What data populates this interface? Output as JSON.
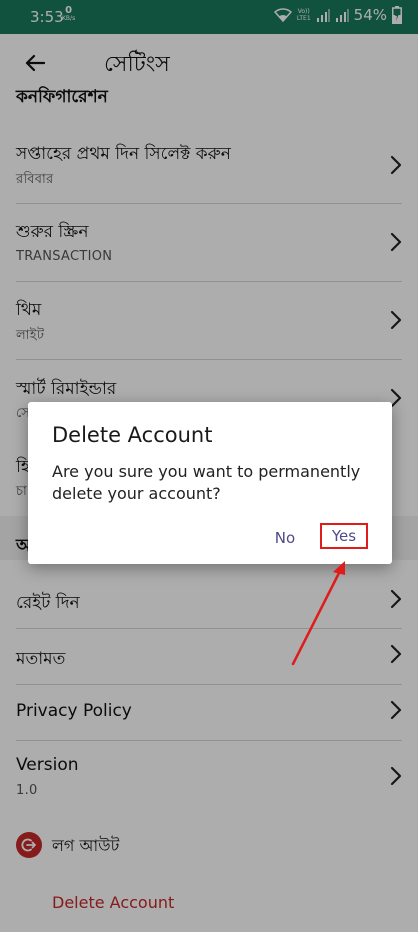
{
  "status_bar": {
    "time": "3:53",
    "net_speed_value": "0",
    "net_speed_unit": "KB/s",
    "volte_top": "Vo))",
    "volte_bottom": "LTE1",
    "battery": "54%"
  },
  "app_bar": {
    "title": "সেটিংস",
    "back_icon": "arrow-left-icon"
  },
  "sections": {
    "configuration_header": "কনফিগারেশন",
    "second_header_initial": "অ"
  },
  "settings": {
    "first_day": {
      "title": "সপ্তাহের প্রথম দিন সিলেক্ট করুন",
      "value": "রবিবার"
    },
    "start_screen": {
      "title": "শুরুর স্ক্রিন",
      "value": "TRANSACTION"
    },
    "theme": {
      "title": "থিম",
      "value": "লাইট"
    },
    "smart_reminder": {
      "title": "স্মার্ট রিমাইন্ডার",
      "value": "সে"
    },
    "hidden_row": {
      "title": "হি",
      "value": "চা"
    },
    "rate": {
      "title": "রেইট দিন"
    },
    "feedback": {
      "title": "মতামত"
    },
    "privacy": {
      "title": "Privacy Policy"
    },
    "version": {
      "title": "Version",
      "value": "1.0"
    }
  },
  "account": {
    "logout_label": "লগ আউট",
    "delete_label": "Delete Account",
    "logout_icon": "logout-icon"
  },
  "dialog": {
    "title": "Delete Account",
    "message": "Are you sure you want to permanently delete your account?",
    "no_label": "No",
    "yes_label": "Yes"
  },
  "colors": {
    "status_bar": "#1a7a5e",
    "accent_text": "#4e4a8a",
    "danger": "#c62828",
    "highlight": "#e01b1b"
  }
}
